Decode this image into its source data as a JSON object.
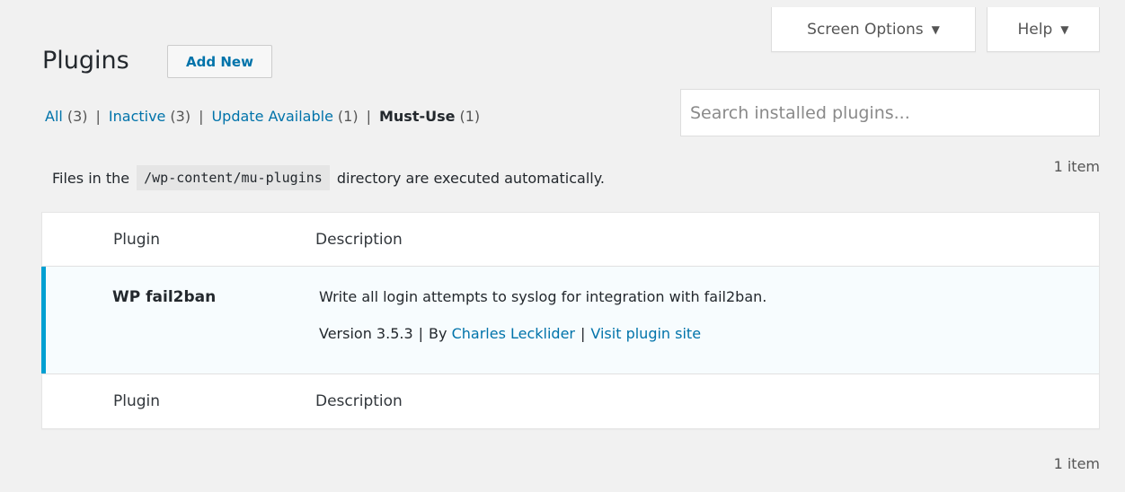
{
  "screen_meta": {
    "screen_options_label": "Screen Options",
    "help_label": "Help"
  },
  "header": {
    "title": "Plugins",
    "add_new_label": "Add New"
  },
  "filters": [
    {
      "label": "All",
      "count": "(3)"
    },
    {
      "label": "Inactive",
      "count": "(3)"
    },
    {
      "label": "Update Available",
      "count": "(1)"
    },
    {
      "label": "Must-Use",
      "count": "(1)",
      "current": true
    }
  ],
  "filter_separator": "|",
  "search": {
    "placeholder": "Search installed plugins..."
  },
  "info": {
    "prefix": "Files in the",
    "path": "/wp-content/mu-plugins",
    "suffix": "directory are executed automatically."
  },
  "items_count": "1 item",
  "table": {
    "columns": {
      "plugin": "Plugin",
      "description": "Description"
    },
    "rows": [
      {
        "name": "WP fail2ban",
        "description": "Write all login attempts to syslog for integration with fail2ban.",
        "version": "Version 3.5.3",
        "by_prefix": "By",
        "author": "Charles Lecklider",
        "visit_label": "Visit plugin site",
        "separator": "|"
      }
    ]
  },
  "colors": {
    "link": "#0073aa",
    "active_row_border": "#00a0d2",
    "active_row_bg": "#f7fcfe",
    "page_bg": "#f1f1f1"
  }
}
